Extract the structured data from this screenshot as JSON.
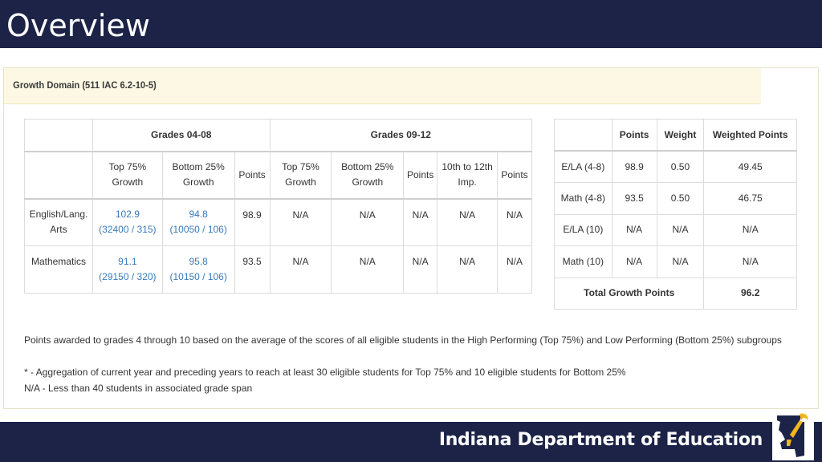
{
  "header": {
    "title": "Overview"
  },
  "panel": {
    "title": "Growth Domain (511 IAC 6.2-10-5)"
  },
  "grade_table": {
    "group_headers": [
      "Grades 04-08",
      "Grades 09-12"
    ],
    "columns": [
      [
        "Top 75%",
        "Growth"
      ],
      [
        "Bottom 25%",
        "Growth"
      ],
      [
        "Points",
        ""
      ],
      [
        "Top 75%",
        "Growth"
      ],
      [
        "Bottom 25%",
        "Growth"
      ],
      [
        "Points",
        ""
      ],
      [
        "10th to 12th",
        "Imp."
      ],
      [
        "Points",
        ""
      ]
    ],
    "rows": [
      {
        "subject": [
          "English/Lang.",
          "Arts"
        ],
        "top75": [
          "102.9",
          "(32400 / 315)"
        ],
        "bottom25": [
          "94.8",
          "(10050 / 106)"
        ],
        "points": "98.9",
        "hs": [
          "N/A",
          "N/A",
          "N/A",
          "N/A",
          "N/A"
        ]
      },
      {
        "subject": [
          "Mathematics",
          ""
        ],
        "top75": [
          "91.1",
          "(29150 / 320)"
        ],
        "bottom25": [
          "95.8",
          "(10150 / 106)"
        ],
        "points": "93.5",
        "hs": [
          "N/A",
          "N/A",
          "N/A",
          "N/A",
          "N/A"
        ]
      }
    ]
  },
  "summary_table": {
    "headers": [
      "Points",
      "Weight",
      "Weighted Points"
    ],
    "rows": [
      {
        "label": "E/LA (4-8)",
        "points": "98.9",
        "weight": "0.50",
        "weighted": "49.45"
      },
      {
        "label": "Math (4-8)",
        "points": "93.5",
        "weight": "0.50",
        "weighted": "46.75"
      },
      {
        "label": "E/LA (10)",
        "points": "N/A",
        "weight": "N/A",
        "weighted": "N/A"
      },
      {
        "label": "Math (10)",
        "points": "N/A",
        "weight": "N/A",
        "weighted": "N/A"
      }
    ],
    "total_label": "Total Growth Points",
    "total_value": "96.2"
  },
  "notes": {
    "n1": "Points awarded to grades 4 through 10 based on the average of the scores of all eligible students in the High Performing (Top 75%) and Low Performing (Bottom 25%) subgroups",
    "n2": "* - Aggregation of current year and preceding years to reach at least 30 eligible students for Top 75% and 10 eligible students for Bottom 25%",
    "n3": "N/A - Less than 40 students in associated grade span"
  },
  "footer": {
    "org": "Indiana Department of Education",
    "logo_icon": "torch-icon"
  },
  "colors": {
    "navy": "#1c2347",
    "panel_head": "#fcf8e3",
    "link_blue": "#3a7ab8",
    "logo_gold": "#f2b71e"
  }
}
